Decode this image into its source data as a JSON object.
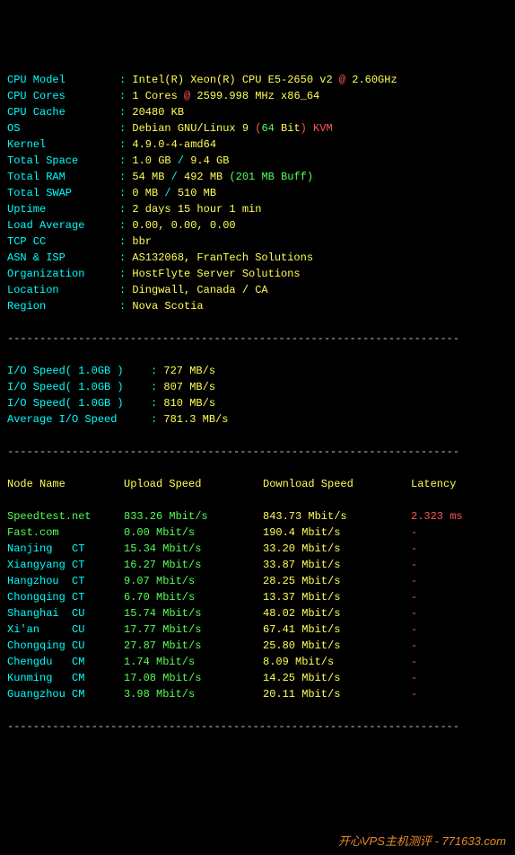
{
  "system": {
    "cpu_model_label": "CPU Model",
    "cpu_model_prefix": "Intel(R) Xeon(R) CPU E5-2650 v2 ",
    "cpu_model_at": "@",
    "cpu_model_freq": " 2.60GHz",
    "cpu_cores_label": "CPU Cores",
    "cpu_cores_prefix": "1 Cores ",
    "cpu_cores_at": "@",
    "cpu_cores_freq": " 2599.998 MHz x86_64",
    "cpu_cache_label": "CPU Cache",
    "cpu_cache": "20480 KB",
    "os_label": "OS",
    "os_name": "Debian GNU/Linux 9 ",
    "os_bit_open": "(",
    "os_bit_num": "64",
    "os_bit_text": " Bit",
    "os_bit_close": ")",
    "os_virt": " KVM",
    "kernel_label": "Kernel",
    "kernel": "4.9.0-4-amd64",
    "space_label": "Total Space",
    "space_used": "1.0 GB",
    "space_sep": " / ",
    "space_total": "9.4 GB",
    "ram_label": "Total RAM",
    "ram_used": "54 MB",
    "ram_sep": " / ",
    "ram_total": "492 MB ",
    "ram_buff": "(201 MB Buff)",
    "swap_label": "Total SWAP",
    "swap_used": "0 MB",
    "swap_sep": " / ",
    "swap_total": "510 MB",
    "uptime_label": "Uptime",
    "uptime": "2 days 15 hour 1 min",
    "load_label": "Load Average",
    "load": "0.00, 0.00, 0.00",
    "tcp_label": "TCP CC",
    "tcp": "bbr",
    "asn_label": "ASN & ISP",
    "asn": "AS132068, FranTech Solutions",
    "org_label": "Organization",
    "org": "HostFlyte Server Solutions",
    "loc_label": "Location",
    "loc": "Dingwall, Canada / CA",
    "region_label": "Region",
    "region": "Nova Scotia"
  },
  "io": {
    "test1_label": "I/O Speed( 1.0GB )",
    "test1": "727 MB/s",
    "test2_label": "I/O Speed( 1.0GB )",
    "test2": "807 MB/s",
    "test3_label": "I/O Speed( 1.0GB )",
    "test3": "810 MB/s",
    "avg_label": "Average I/O Speed",
    "avg": "781.3 MB/s"
  },
  "headers": {
    "node": "Node Name",
    "upload": "Upload Speed",
    "download": "Download Speed",
    "latency": "Latency"
  },
  "speed": [
    {
      "node": "Speedtest.net",
      "up": "833.26 Mbit/s",
      "down": "843.73 Mbit/s",
      "lat": "2.323 ms",
      "color": "green"
    },
    {
      "node": "Fast.com",
      "up": "0.00 Mbit/s",
      "down": "190.4 Mbit/s",
      "lat": "-",
      "color": "green"
    },
    {
      "node": "Nanjing   CT",
      "up": "15.34 Mbit/s",
      "down": "33.20 Mbit/s",
      "lat": "-",
      "color": "cyan"
    },
    {
      "node": "Xiangyang CT",
      "up": "16.27 Mbit/s",
      "down": "33.87 Mbit/s",
      "lat": "-",
      "color": "cyan"
    },
    {
      "node": "Hangzhou  CT",
      "up": "9.07 Mbit/s",
      "down": "28.25 Mbit/s",
      "lat": "-",
      "color": "cyan"
    },
    {
      "node": "Chongqing CT",
      "up": "6.70 Mbit/s",
      "down": "13.37 Mbit/s",
      "lat": "-",
      "color": "cyan"
    },
    {
      "node": "Shanghai  CU",
      "up": "15.74 Mbit/s",
      "down": "48.02 Mbit/s",
      "lat": "-",
      "color": "cyan"
    },
    {
      "node": "Xi'an     CU",
      "up": "17.77 Mbit/s",
      "down": "67.41 Mbit/s",
      "lat": "-",
      "color": "cyan"
    },
    {
      "node": "Chongqing CU",
      "up": "27.87 Mbit/s",
      "down": "25.80 Mbit/s",
      "lat": "-",
      "color": "cyan"
    },
    {
      "node": "Chengdu   CM",
      "up": "1.74 Mbit/s",
      "down": "8.09 Mbit/s",
      "lat": "-",
      "color": "cyan"
    },
    {
      "node": "Kunming   CM",
      "up": "17.08 Mbit/s",
      "down": "14.25 Mbit/s",
      "lat": "-",
      "color": "cyan"
    },
    {
      "node": "Guangzhou CM",
      "up": "3.98 Mbit/s",
      "down": "20.11 Mbit/s",
      "lat": "-",
      "color": "cyan"
    }
  ],
  "divider": "----------------------------------------------------------------------",
  "watermark": "开心VPS主机测评 - 771633.com"
}
